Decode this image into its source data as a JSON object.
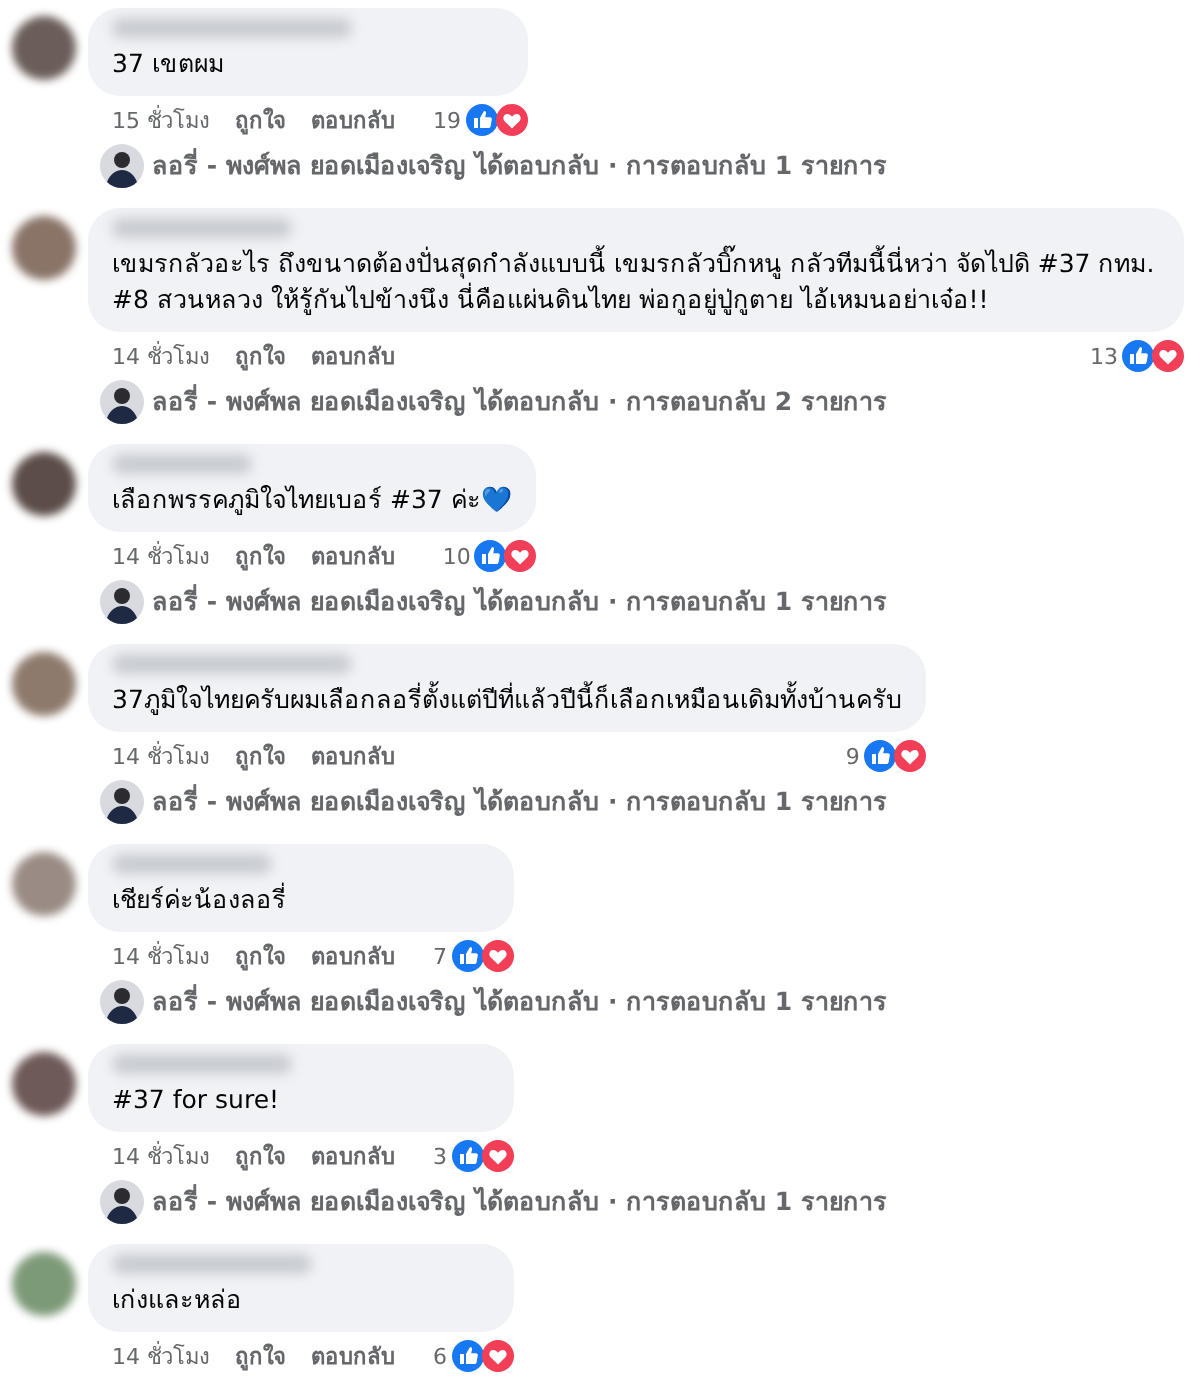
{
  "comments": [
    {
      "text": "37 เขตผม",
      "time": "15 ชั่วโมง",
      "like_label": "ถูกใจ",
      "reply_label": "ตอบกลับ",
      "reaction_count": "19",
      "reply_summary": "ลอรี่ - พงศ์พล ยอดเมืองเจริญ ได้ตอบกลับ · การตอบกลับ 1 รายการ"
    },
    {
      "text": "เขมรกลัวอะไร ถึงขนาดต้องปั่นสุดกำลังแบบนี้ เขมรกลัวบิ๊กหนู กลัวทีมนี้นี่หว่า จัดไปดิ #37 กทม. #8 สวนหลวง ให้รู้กันไปข้างนึง นี่คือแผ่นดินไทย พ่อกูอยู่ปู่กูตาย ไอ้เหมนอย่าเจ๋อ!!",
      "time": "14 ชั่วโมง",
      "like_label": "ถูกใจ",
      "reply_label": "ตอบกลับ",
      "reaction_count": "13",
      "reply_summary": "ลอรี่ - พงศ์พล ยอดเมืองเจริญ ได้ตอบกลับ · การตอบกลับ 2 รายการ"
    },
    {
      "text": "เลือกพรรคภูมิใจไทยเบอร์ #37 ค่ะ💙",
      "time": "14 ชั่วโมง",
      "like_label": "ถูกใจ",
      "reply_label": "ตอบกลับ",
      "reaction_count": "10",
      "reply_summary": "ลอรี่ - พงศ์พล ยอดเมืองเจริญ ได้ตอบกลับ · การตอบกลับ 1 รายการ"
    },
    {
      "text": "37ภูมิใจไทยครับผมเลือกลอรี่ตั้งแต่ปีที่แล้วปีนี้ก็เลือกเหมือนเดิมทั้งบ้านครับ",
      "time": "14 ชั่วโมง",
      "like_label": "ถูกใจ",
      "reply_label": "ตอบกลับ",
      "reaction_count": "9",
      "reply_summary": "ลอรี่ - พงศ์พล ยอดเมืองเจริญ ได้ตอบกลับ · การตอบกลับ 1 รายการ"
    },
    {
      "text": "เชียร์ค่ะน้องลอรี่",
      "time": "14 ชั่วโมง",
      "like_label": "ถูกใจ",
      "reply_label": "ตอบกลับ",
      "reaction_count": "7",
      "reply_summary": "ลอรี่ - พงศ์พล ยอดเมืองเจริญ ได้ตอบกลับ · การตอบกลับ 1 รายการ"
    },
    {
      "text": "#37 for sure!",
      "time": "14 ชั่วโมง",
      "like_label": "ถูกใจ",
      "reply_label": "ตอบกลับ",
      "reaction_count": "3",
      "reply_summary": "ลอรี่ - พงศ์พล ยอดเมืองเจริญ ได้ตอบกลับ · การตอบกลับ 1 รายการ"
    },
    {
      "text": "เก่งและหล่อ",
      "time": "14 ชั่วโมง",
      "like_label": "ถูกใจ",
      "reply_label": "ตอบกลับ",
      "reaction_count": "6"
    }
  ]
}
